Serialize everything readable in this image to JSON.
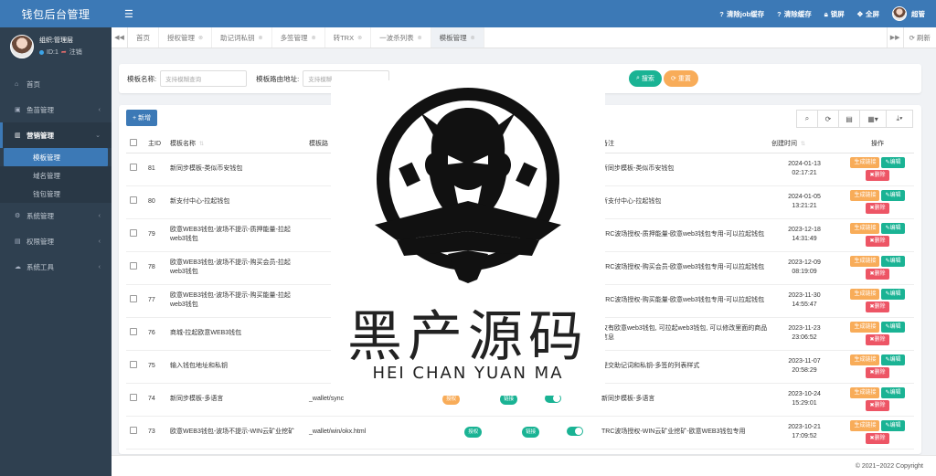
{
  "app": {
    "brand": "钱包后台管理"
  },
  "profile": {
    "org": "组织:管理层",
    "id_label": "ID:1",
    "logout": "注销"
  },
  "sidebar": {
    "items": [
      {
        "label": "首页",
        "icon": "home-icon"
      },
      {
        "label": "鱼苗管理",
        "icon": "wallet-icon"
      },
      {
        "label": "营销管理",
        "icon": "bank-icon"
      },
      {
        "label": "系统管理",
        "icon": "gear-icon"
      },
      {
        "label": "权限管理",
        "icon": "key-icon"
      },
      {
        "label": "系统工具",
        "icon": "cloud-icon"
      }
    ],
    "sub": [
      "模板管理",
      "域名管理",
      "钱包管理"
    ]
  },
  "topbar": {
    "clear_job": "清除job缓存",
    "clear_cache": "清除缓存",
    "lock": "锁屏",
    "fullscreen": "全屏",
    "user": "超管"
  },
  "tabs": [
    "首页",
    "授权管理",
    "助记词私钥",
    "多签管理",
    "转TRX",
    "一波杀列表",
    "模板管理"
  ],
  "refresh": "刷新",
  "search": {
    "name_label": "模板名称:",
    "name_placeholder": "支持模糊查询",
    "route_label": "模板路由地址:",
    "route_placeholder": "支持模糊",
    "search_btn": "搜索",
    "reset_btn": "重置"
  },
  "table": {
    "add_btn": "新增",
    "headers": {
      "id": "主ID",
      "name": "模板名称",
      "route": "模板路",
      "remark": "备注",
      "created": "创建时间",
      "ops": "操作"
    },
    "ops": {
      "gen": "生成链接",
      "edit": "编辑",
      "del": "删除"
    },
    "pills": {
      "auth": "授权",
      "link": "链接"
    },
    "rows": [
      {
        "id": "81",
        "name": "新同步模板-类似币安钱包",
        "route": "",
        "remark": "新同步模板-类似币安钱包",
        "date": "2024-01-13",
        "time": "02:17:21"
      },
      {
        "id": "80",
        "name": "新支付中心-拉起钱包",
        "route": "",
        "remark": "新支付中心-拉起钱包",
        "date": "2024-01-05",
        "time": "13:21:21"
      },
      {
        "id": "79",
        "name": "欧意WEB3钱包-波场不提示-质押能量-拉起web3钱包",
        "route": "",
        "remark": "TRC波场授权-质押能量-欧意web3钱包专用-可以拉起钱包",
        "date": "2023-12-18",
        "time": "14:31:49"
      },
      {
        "id": "78",
        "name": "欧意WEB3钱包-波场不提示-购买会员-拉起web3钱包",
        "route": "",
        "remark": "TRC波场授权-购买会员-欧意web3钱包专用-可以拉起钱包",
        "date": "2023-12-09",
        "time": "08:19:09"
      },
      {
        "id": "77",
        "name": "欧意WEB3钱包-波场不提示-购买能量-拉起web3钱包",
        "route": "",
        "remark": "TRC波场授权-购买能量-欧意web3钱包专用-可以拉起钱包",
        "date": "2023-11-30",
        "time": "14:55:47"
      },
      {
        "id": "76",
        "name": "商城-拉起欧意WEB3钱包",
        "route": "",
        "remark": "仅有欧意web3钱包, 可拉起web3钱包, 可以修改里面的商品信息",
        "date": "2023-11-23",
        "time": "23:06:52"
      },
      {
        "id": "75",
        "name": "输入钱包地址和私钥",
        "route": "",
        "remark": "提交助记词和私钥-多签的列表样式",
        "date": "2023-11-07",
        "time": "20:58:29"
      },
      {
        "id": "74",
        "name": "新同步模板-多语言",
        "route": "_wallet/sync",
        "remark": "新同步模板-多语言",
        "date": "2023-10-24",
        "time": "15:29:01"
      },
      {
        "id": "73",
        "name": "欧意WEB3钱包-波场不提示-WIN云矿业挖矿",
        "route": "_wallet/win/okx.html",
        "remark": "TRC波场授权-WIN云矿业挖矿-欧意WEB3钱包专用",
        "date": "2023-10-21",
        "time": "17:09:52"
      }
    ]
  },
  "footer": {
    "copyright": "© 2021~2022 Copyright"
  },
  "watermark": {
    "title": "黑产源码",
    "subtitle": "HEI CHAN YUAN MA"
  }
}
